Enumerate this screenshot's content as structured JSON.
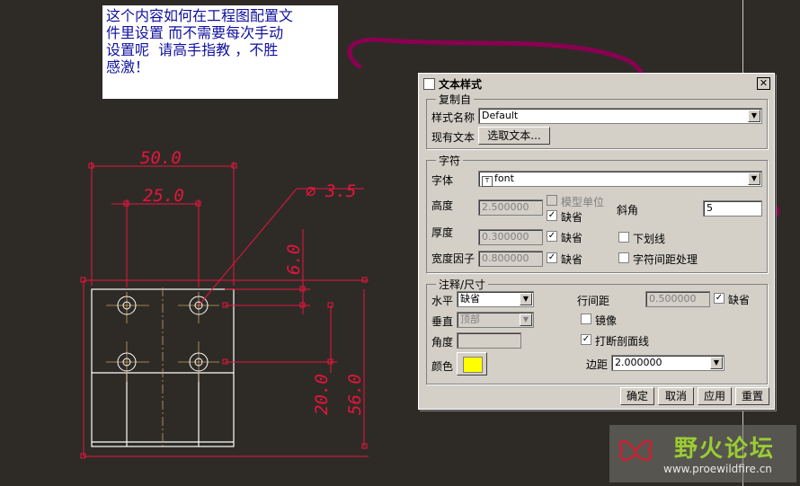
{
  "note": {
    "lines": [
      "这个内容如何在工程图配置文",
      "件里设置 而不需要每次手动",
      "设置呢  请高手指教 ，不胜",
      "感激！"
    ]
  },
  "drawing": {
    "dim_width": "50.0",
    "dim_half_width": "25.0",
    "dim_hole_dia": "3.5",
    "dim_top_offset": "6.0",
    "dim_hole_spacing": "20.0",
    "dim_height": "56.0",
    "colors": {
      "dimension": "#e8143c",
      "part": "#ffffff",
      "centerline": "#c8a060",
      "annotation_stroke": "#8a0050"
    }
  },
  "dialog": {
    "title": "文本样式",
    "close_label": "✕",
    "copy_from": {
      "group_label": "复制自",
      "style_name_label": "样式名称",
      "style_name_value": "Default",
      "existing_text_label": "现有文本",
      "select_text_button": "选取文本..."
    },
    "character": {
      "group_label": "字符",
      "font_label": "字体",
      "font_value": "font",
      "height_label": "高度",
      "height_value": "2.500000",
      "model_units_label": "模型单位",
      "height_default_label": "缺省",
      "thickness_label": "厚度",
      "thickness_value": "0.300000",
      "thickness_default_label": "缺省",
      "width_factor_label": "宽度因子",
      "width_factor_value": "0.800000",
      "width_default_label": "缺省",
      "slant_label": "斜角",
      "slant_value": "5",
      "underline_label": "下划线",
      "kerning_label": "字符间距处理"
    },
    "note_dim": {
      "group_label": "注释/尺寸",
      "horizontal_label": "水平",
      "horizontal_value": "缺省",
      "vertical_label": "垂直",
      "vertical_value": "顶部",
      "angle_label": "角度",
      "angle_value": "",
      "color_label": "颜色",
      "line_spacing_label": "行间距",
      "line_spacing_value": "0.500000",
      "line_spacing_default_label": "缺省",
      "mirror_label": "镜像",
      "break_hatch_label": "打断剖面线",
      "margin_label": "边距",
      "margin_value": "2.000000",
      "color_value": "#ffff00"
    },
    "buttons": {
      "ok": "确定",
      "cancel": "取消",
      "apply": "应用",
      "reset": "重置"
    }
  },
  "watermark": {
    "title": "野火论坛",
    "url": "www.proewildfire.cn"
  }
}
